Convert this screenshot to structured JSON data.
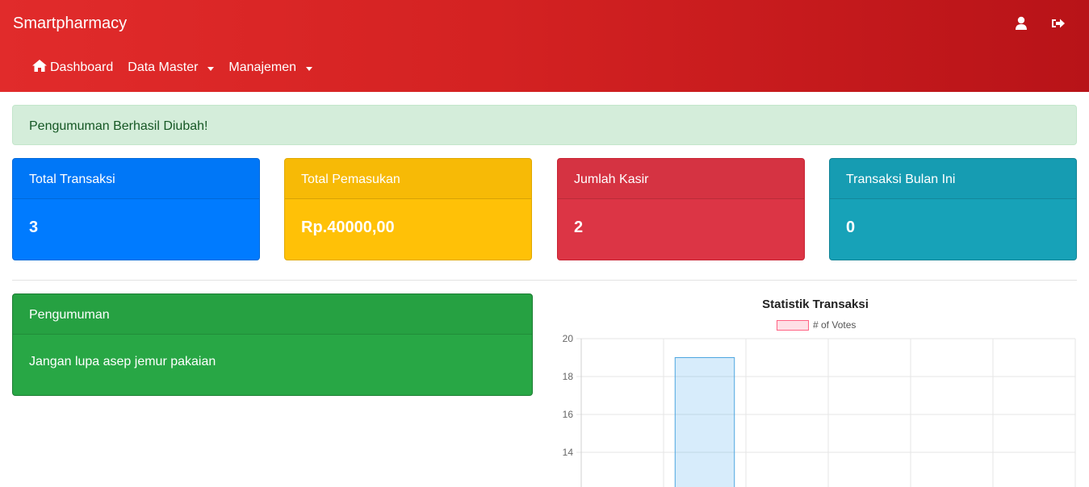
{
  "app": {
    "brand": "Smartpharmacy"
  },
  "nav": {
    "icons": [
      {
        "name": "user-icon"
      },
      {
        "name": "sign-out-icon"
      }
    ],
    "items": [
      {
        "label": "Dashboard",
        "icon": "home-icon",
        "dropdown": false
      },
      {
        "label": "Data Master",
        "dropdown": true
      },
      {
        "label": "Manajemen",
        "dropdown": true
      }
    ]
  },
  "alert": {
    "text": "Pengumuman Berhasil Diubah!",
    "color": "#d4edda"
  },
  "stats": [
    {
      "title": "Total Transaksi",
      "value": "3",
      "color": "#007bff"
    },
    {
      "title": "Total Pemasukan",
      "value": "Rp.40000,00",
      "color": "#ffc107"
    },
    {
      "title": "Jumlah Kasir",
      "value": "2",
      "color": "#dc3545"
    },
    {
      "title": "Transaksi Bulan Ini",
      "value": "0",
      "color": "#17a2b8"
    }
  ],
  "announcement": {
    "title": "Pengumuman",
    "body": "Jangan lupa asep jemur pakaian",
    "color": "#28a745"
  },
  "chart_data": {
    "type": "bar",
    "title": "Statistik Transaksi",
    "legend": [
      "# of Votes"
    ],
    "y_ticks": [
      20,
      18,
      16,
      14
    ],
    "ylim_visible": [
      12.2,
      20
    ],
    "series": [
      {
        "name": "# of Votes",
        "values": [
          null,
          19,
          null,
          null,
          null,
          null
        ]
      }
    ]
  }
}
